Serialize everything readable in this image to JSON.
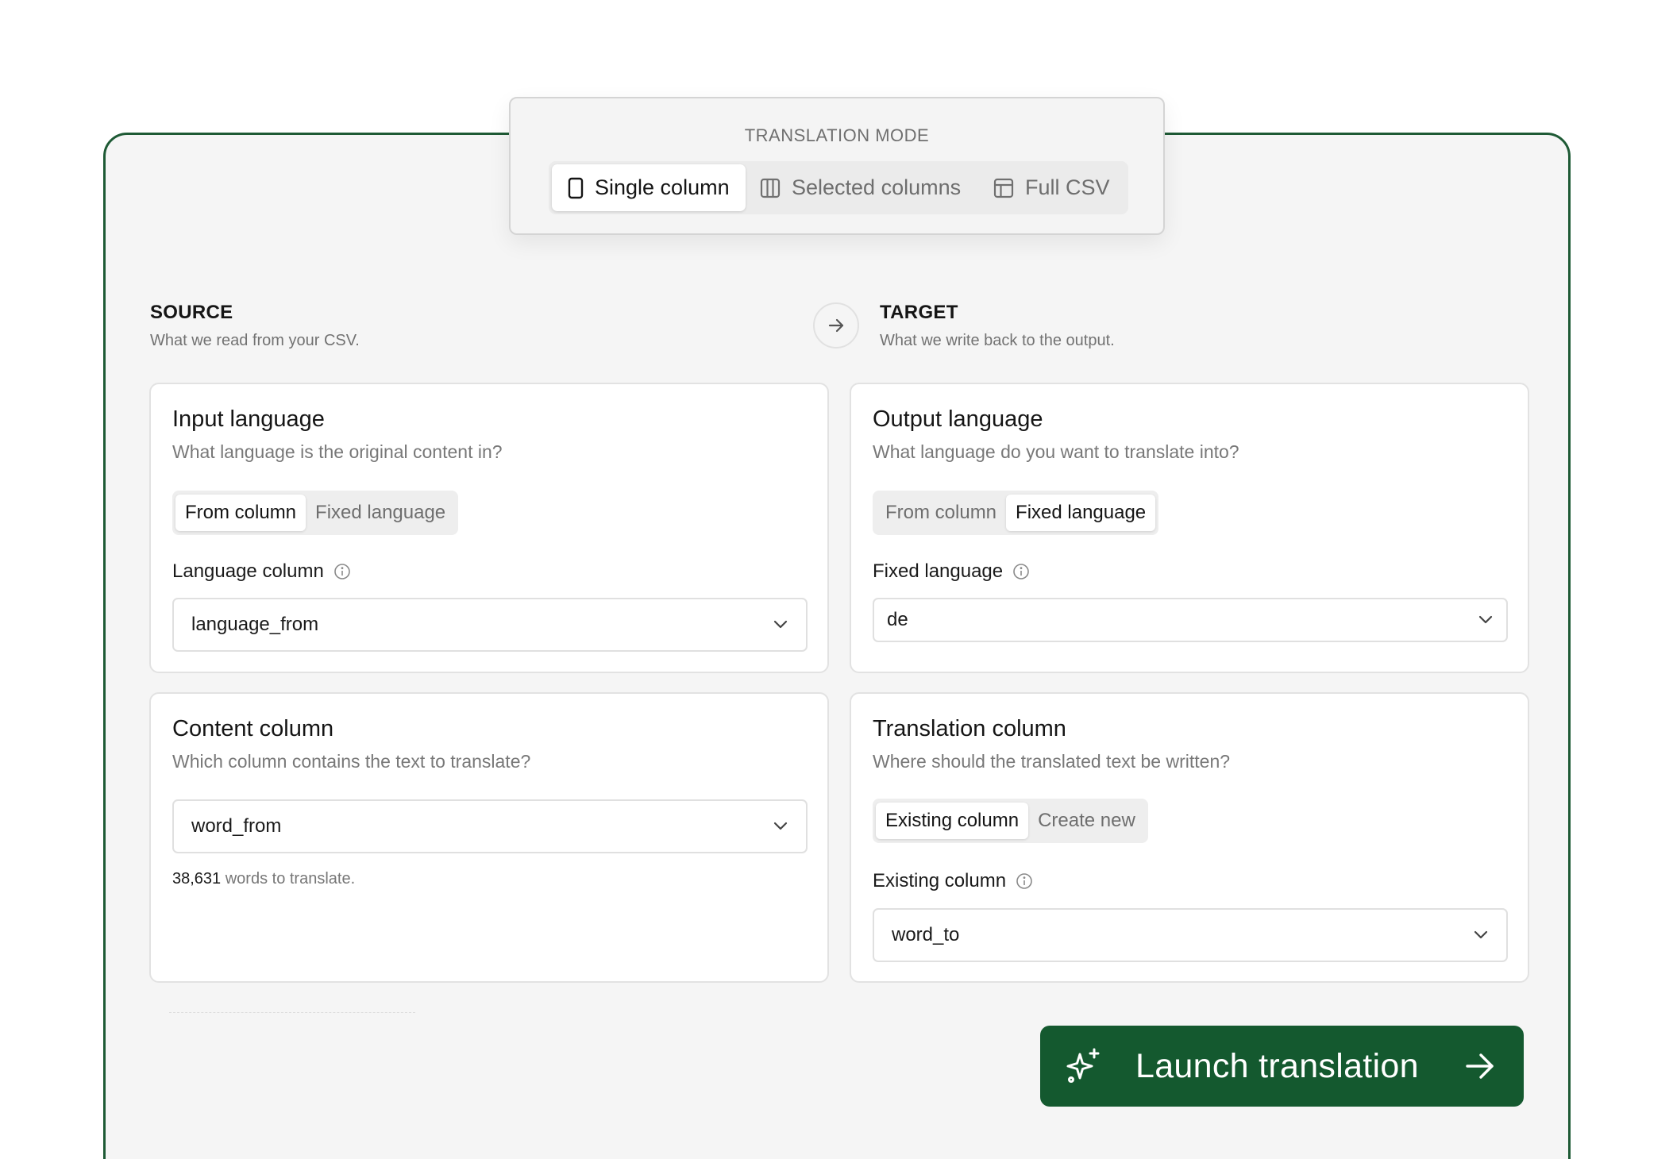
{
  "mode": {
    "label": "TRANSLATION MODE",
    "options": [
      "Single column",
      "Selected columns",
      "Full CSV"
    ],
    "selected": "Single column"
  },
  "source": {
    "title": "SOURCE",
    "subtitle": "What we read from your CSV."
  },
  "target": {
    "title": "TARGET",
    "subtitle": "What we write back to the output."
  },
  "input_language": {
    "title": "Input language",
    "subtitle": "What language is the original content in?",
    "toggle": [
      "From column",
      "Fixed language"
    ],
    "toggle_selected": "From column",
    "field_label": "Language column",
    "value": "language_from"
  },
  "output_language": {
    "title": "Output language",
    "subtitle": "What language do you want to translate into?",
    "toggle": [
      "From column",
      "Fixed language"
    ],
    "toggle_selected": "Fixed language",
    "field_label": "Fixed language",
    "value": "de"
  },
  "content_column": {
    "title": "Content column",
    "subtitle": "Which column contains the text to translate?",
    "value": "word_from",
    "count": "38,631",
    "count_suffix": " words to translate."
  },
  "translation_column": {
    "title": "Translation column",
    "subtitle": "Where should the translated text be written?",
    "toggle": [
      "Existing column",
      "Create new"
    ],
    "toggle_selected": "Existing column",
    "field_label": "Existing column",
    "value": "word_to"
  },
  "launch": {
    "label": "Launch translation"
  },
  "colors": {
    "accent": "#14592f",
    "frame_border": "#1e5a35",
    "panel_bg": "#f5f5f5"
  }
}
